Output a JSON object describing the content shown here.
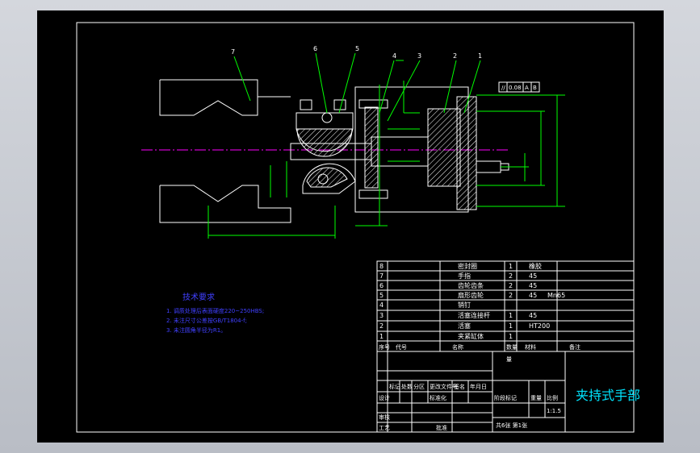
{
  "title_block": {
    "drawing_title": "夹持式手部",
    "scale_value": "1:1.5",
    "sheet_info": "共6张  第1张"
  },
  "notes": {
    "heading": "技术要求",
    "items": [
      "1. 调质处理后表面硬度220~250HBS;",
      "2. 未注尺寸公差按GB/T1804-f;",
      "3. 未注圆角半径为R1。"
    ]
  },
  "bom": {
    "rows": [
      {
        "no": "8",
        "name": "密封圈",
        "qty": "1",
        "material": "橡胶"
      },
      {
        "no": "7",
        "name": "手指",
        "qty": "2",
        "material": "45"
      },
      {
        "no": "6",
        "name": "齿轮齿条",
        "qty": "2",
        "material": "45"
      },
      {
        "no": "5",
        "name": "扇形齿轮",
        "qty": "2",
        "material": "45",
        "note": "Mn65"
      },
      {
        "no": "4",
        "name": "销钉",
        "qty": "",
        "material": ""
      },
      {
        "no": "3",
        "name": "活塞连接杆",
        "qty": "1",
        "material": "45"
      },
      {
        "no": "2",
        "name": "活塞",
        "qty": "1",
        "material": "HT200"
      },
      {
        "no": "1",
        "name": "夹紧缸体",
        "qty": "1",
        "material": ""
      }
    ],
    "header": {
      "no": "序号",
      "code": "代号",
      "name": "名称",
      "qty": "数量",
      "material": "材料",
      "note": "备注"
    }
  },
  "block_labels": {
    "mark": "标记",
    "count": "处数",
    "zone": "分区",
    "change_doc": "更改文件号",
    "sign": "签名",
    "date": "年月日",
    "design": "设计",
    "standard": "标准化",
    "stage": "阶段标记",
    "weight": "重量",
    "scale": "比例",
    "check": "审核",
    "process": "工艺",
    "approve": "批准",
    "qty_label": "量"
  },
  "callouts": [
    "1",
    "2",
    "3",
    "4",
    "5",
    "6",
    "7"
  ],
  "tolerance_frame": [
    "//",
    "0.08",
    "A",
    "B"
  ]
}
